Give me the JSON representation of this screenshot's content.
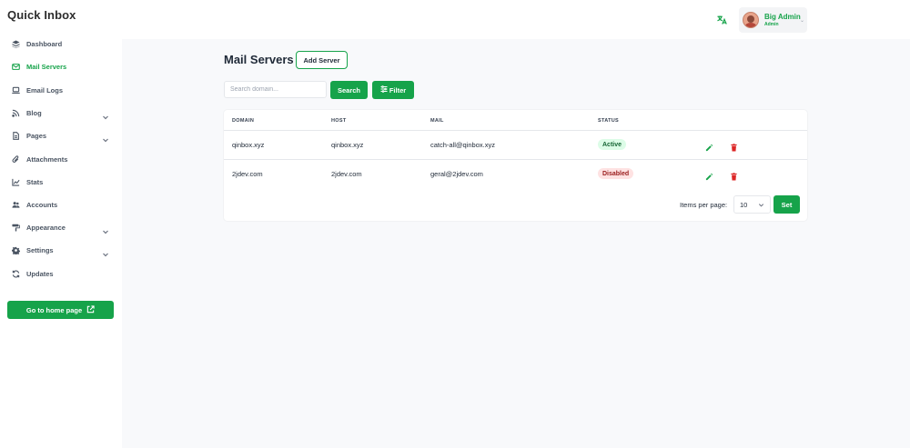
{
  "app": {
    "title": "Quick Inbox"
  },
  "header": {
    "translate_icon": "translate-icon",
    "user": {
      "name": "Big Admin",
      "role": "Admin"
    }
  },
  "sidebar": {
    "items": [
      {
        "label": "Dashboard",
        "icon": "dashboard-icon",
        "active": false,
        "expandable": false
      },
      {
        "label": "Mail Servers",
        "icon": "mail-icon",
        "active": true,
        "expandable": false
      },
      {
        "label": "Email Logs",
        "icon": "laptop-icon",
        "active": false,
        "expandable": false
      },
      {
        "label": "Blog",
        "icon": "rss-icon",
        "active": false,
        "expandable": true
      },
      {
        "label": "Pages",
        "icon": "file-icon",
        "active": false,
        "expandable": true
      },
      {
        "label": "Attachments",
        "icon": "paperclip-icon",
        "active": false,
        "expandable": false
      },
      {
        "label": "Stats",
        "icon": "chart-icon",
        "active": false,
        "expandable": false
      },
      {
        "label": "Accounts",
        "icon": "users-icon",
        "active": false,
        "expandable": false
      },
      {
        "label": "Appearance",
        "icon": "paint-roller-icon",
        "active": false,
        "expandable": true
      },
      {
        "label": "Settings",
        "icon": "gear-icon",
        "active": false,
        "expandable": true
      },
      {
        "label": "Updates",
        "icon": "refresh-icon",
        "active": false,
        "expandable": false
      }
    ],
    "home_button": "Go to home page"
  },
  "main": {
    "title": "Mail Servers",
    "add_button": "Add Server",
    "search": {
      "placeholder": "Search domain...",
      "value": ""
    },
    "search_button": "Search",
    "filter_button": "Filter",
    "table": {
      "columns": [
        "DOMAIN",
        "HOST",
        "MAIL",
        "STATUS"
      ],
      "rows": [
        {
          "domain": "qinbox.xyz",
          "host": "qinbox.xyz",
          "mail": "catch-all@qinbox.xyz",
          "status": "Active"
        },
        {
          "domain": "2jdev.com",
          "host": "2jdev.com",
          "mail": "geral@2jdev.com",
          "status": "Disabled"
        }
      ]
    },
    "pagination": {
      "label": "Items per page:",
      "value": "10",
      "set_button": "Set"
    }
  },
  "colors": {
    "accent": "#16a34a",
    "danger": "#dc2626",
    "active_badge_bg": "#dcfce7",
    "disabled_badge_bg": "#fee2e2"
  }
}
